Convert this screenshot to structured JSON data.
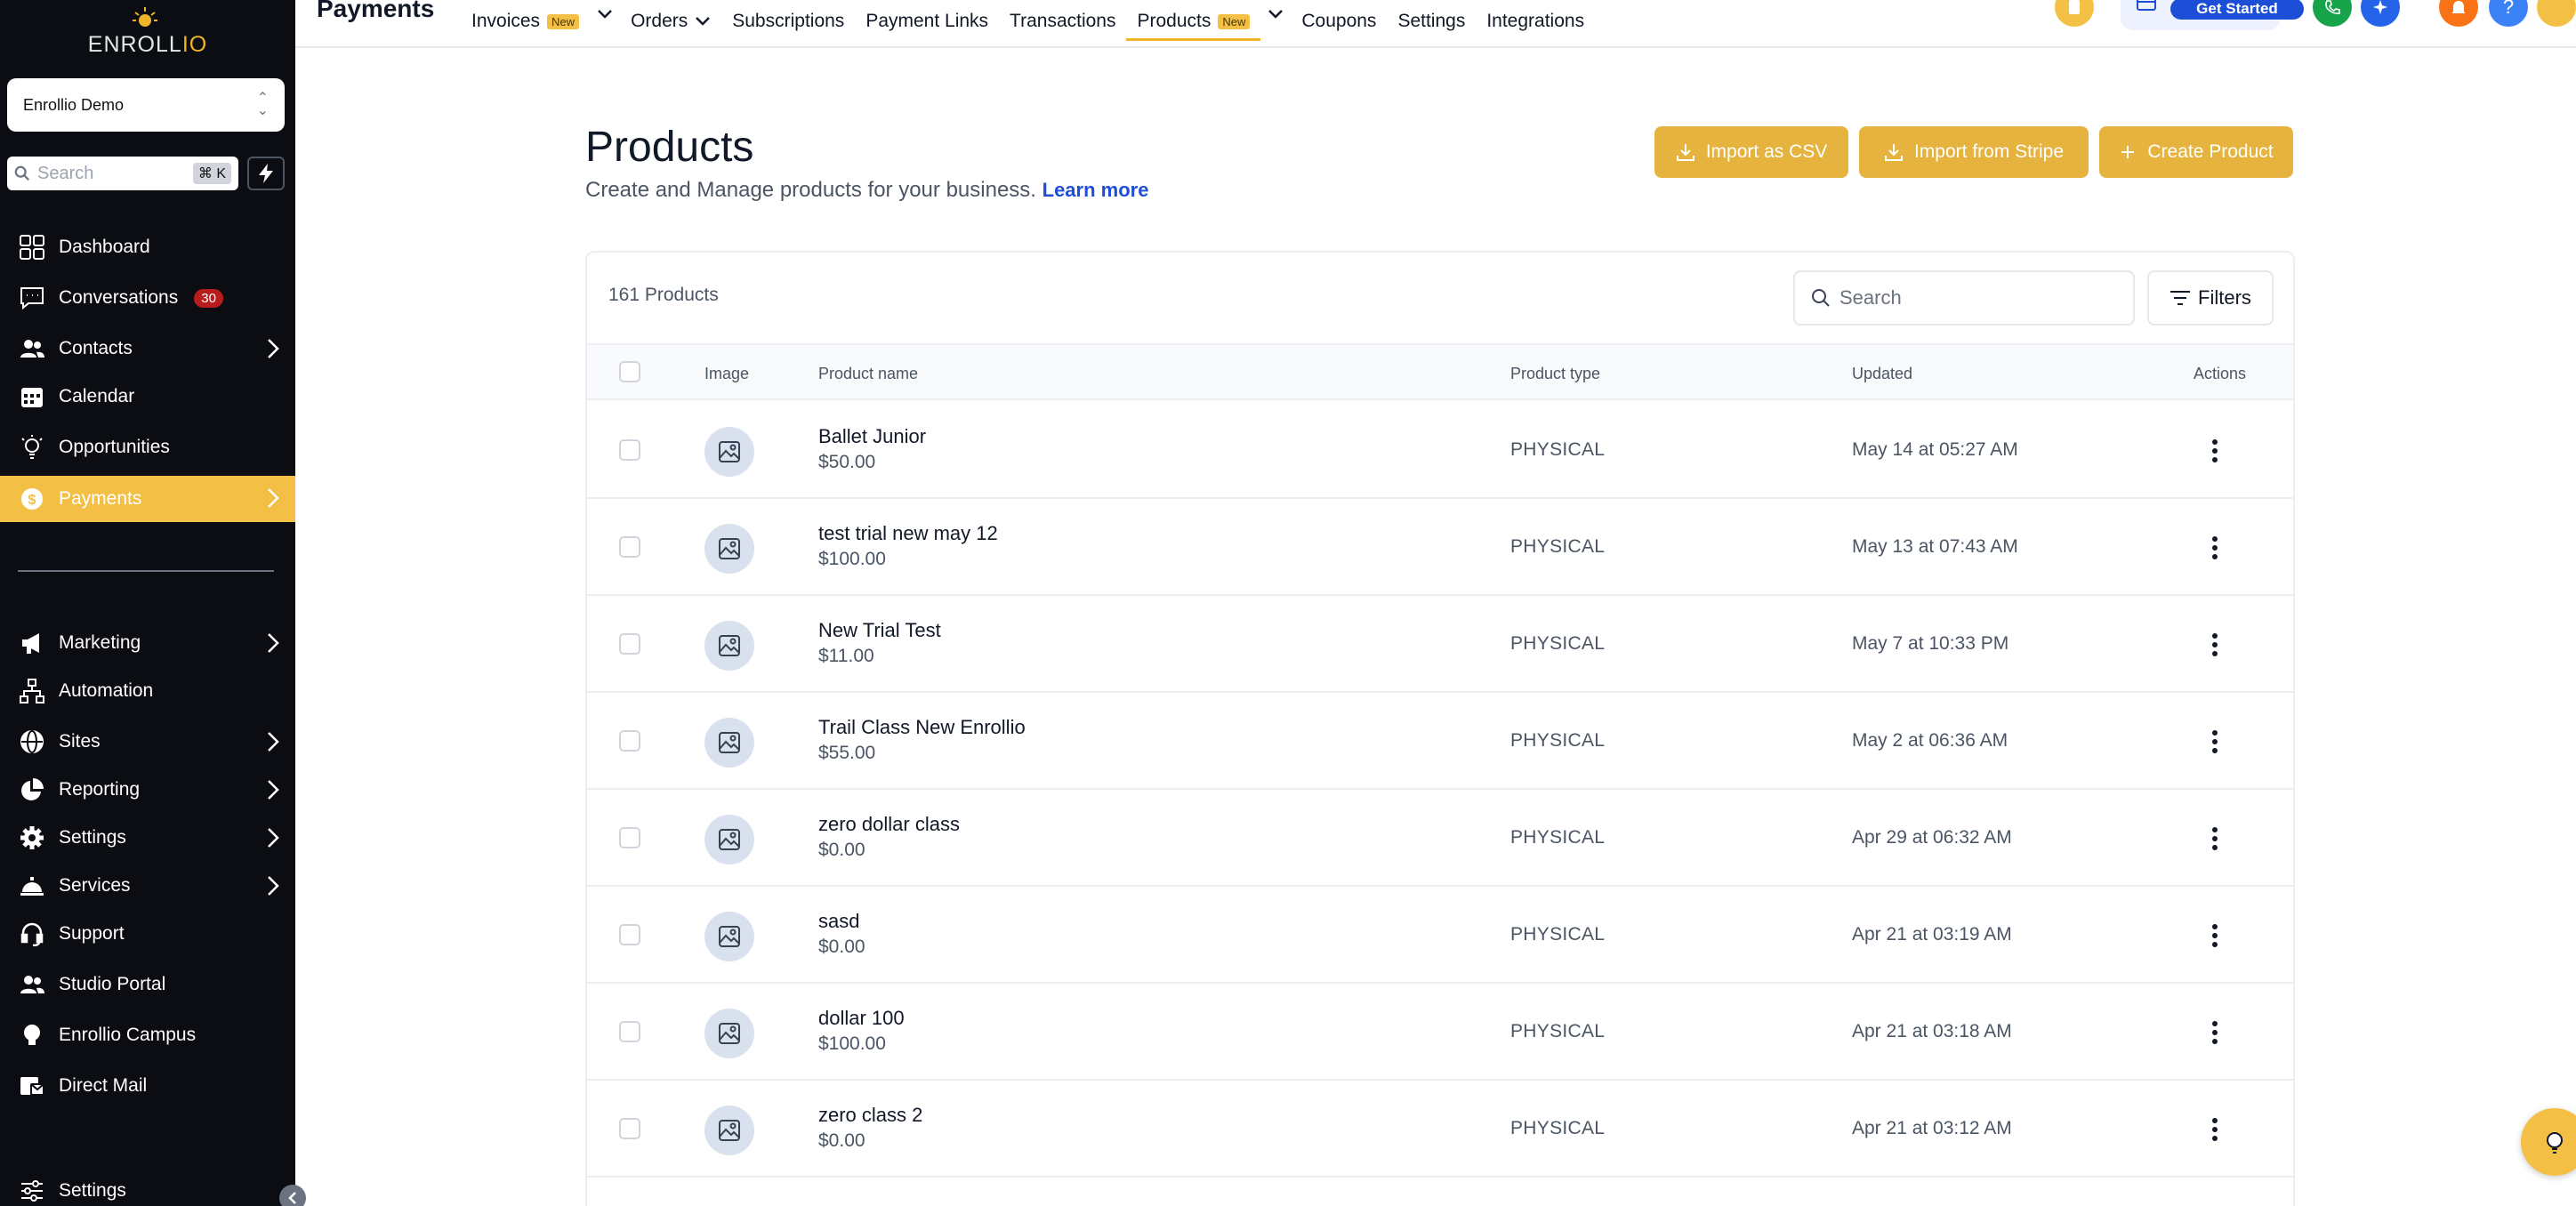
{
  "sidebar": {
    "brand_left": "ENROLL",
    "brand_right": "IO",
    "account": "Enrollio Demo",
    "search_placeholder": "Search",
    "search_shortcut": "⌘ K",
    "items": [
      {
        "label": "Dashboard",
        "icon": "grid-icon"
      },
      {
        "label": "Conversations",
        "icon": "chat-icon",
        "badge": "30"
      },
      {
        "label": "Contacts",
        "icon": "users-icon"
      },
      {
        "label": "Calendar",
        "icon": "calendar-icon"
      },
      {
        "label": "Opportunities",
        "icon": "lightbulb-icon"
      },
      {
        "label": "Payments",
        "icon": "dollar-icon"
      },
      {
        "label": "Marketing",
        "icon": "megaphone-icon"
      },
      {
        "label": "Automation",
        "icon": "workflow-icon"
      },
      {
        "label": "Sites",
        "icon": "globe-icon"
      },
      {
        "label": "Reporting",
        "icon": "pie-icon"
      },
      {
        "label": "Settings",
        "icon": "gear-icon"
      },
      {
        "label": "Services",
        "icon": "bell-service-icon"
      },
      {
        "label": "Support",
        "icon": "headset-icon"
      },
      {
        "label": "Studio Portal",
        "icon": "users-icon"
      },
      {
        "label": "Enrollio Campus",
        "icon": "bulb-icon"
      },
      {
        "label": "Direct Mail",
        "icon": "mail-icon"
      },
      {
        "label": "Settings",
        "icon": "sliders-icon"
      }
    ]
  },
  "topbar": {
    "title": "Payments",
    "tabs": [
      "Invoices",
      "Orders",
      "Subscriptions",
      "Payment Links",
      "Transactions",
      "Products",
      "Coupons",
      "Settings",
      "Integrations"
    ],
    "new_badge": "New",
    "get_started": "Get Started"
  },
  "page": {
    "title": "Products",
    "subtitle": "Create and Manage products for your business.",
    "learn_more": "Learn more",
    "buttons": {
      "import_csv": "Import as CSV",
      "import_stripe": "Import from Stripe",
      "create": "Create Product"
    }
  },
  "table": {
    "count": "161 Products",
    "search_placeholder": "Search",
    "filters": "Filters",
    "headers": {
      "image": "Image",
      "name": "Product name",
      "type": "Product type",
      "updated": "Updated",
      "actions": "Actions"
    },
    "rows": [
      {
        "name": "Ballet Junior",
        "price": "$50.00",
        "type": "PHYSICAL",
        "updated": "May 14 at 05:27 AM"
      },
      {
        "name": "test trial new may 12",
        "price": "$100.00",
        "type": "PHYSICAL",
        "updated": "May 13 at 07:43 AM"
      },
      {
        "name": "New Trial Test",
        "price": "$11.00",
        "type": "PHYSICAL",
        "updated": "May 7 at 10:33 PM"
      },
      {
        "name": "Trail Class New Enrollio",
        "price": "$55.00",
        "type": "PHYSICAL",
        "updated": "May 2 at 06:36 AM"
      },
      {
        "name": "zero dollar class",
        "price": "$0.00",
        "type": "PHYSICAL",
        "updated": "Apr 29 at 06:32 AM"
      },
      {
        "name": "sasd",
        "price": "$0.00",
        "type": "PHYSICAL",
        "updated": "Apr 21 at 03:19 AM"
      },
      {
        "name": "dollar 100",
        "price": "$100.00",
        "type": "PHYSICAL",
        "updated": "Apr 21 at 03:18 AM"
      },
      {
        "name": "zero class 2",
        "price": "$0.00",
        "type": "PHYSICAL",
        "updated": "Apr 21 at 03:12 AM"
      }
    ]
  },
  "colors": {
    "accent": "#f4bf45",
    "sidebar_bg": "#0b0d12",
    "link": "#1d4ed8"
  }
}
